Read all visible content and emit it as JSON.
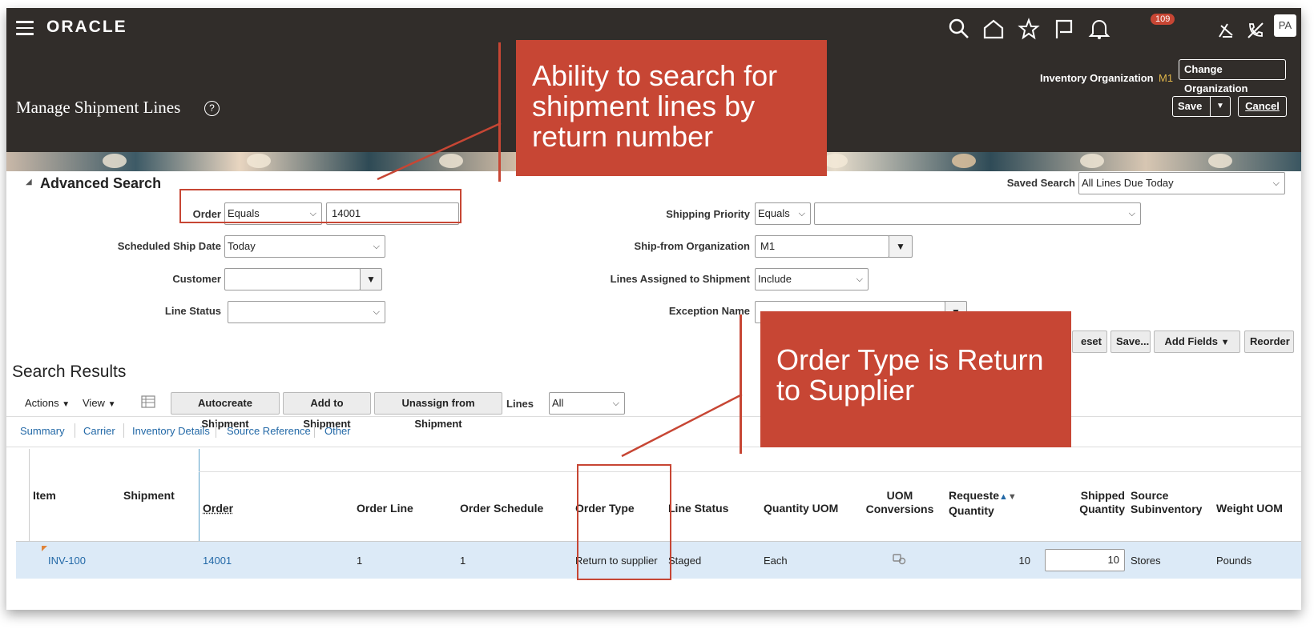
{
  "header": {
    "brand": "ORACLE",
    "notifications_count": "109",
    "avatar_initials": "PA",
    "inventory_org_label": "Inventory Organization",
    "inventory_org_value": "M1",
    "change_org_label": "Change Organization",
    "page_title": "Manage Shipment Lines",
    "help_glyph": "?",
    "save_label": "Save",
    "cancel_label": "Cancel",
    "icons": [
      "menu-icon",
      "search-icon",
      "home-icon",
      "star-icon",
      "flag-icon",
      "bell-icon",
      "sign-icon",
      "phone-off-icon"
    ]
  },
  "search": {
    "title": "Advanced Search",
    "saved_search_label": "Saved Search",
    "saved_search_value": "All Lines Due Today",
    "order_label": "Order",
    "order_operator": "Equals",
    "order_value": "14001",
    "scheduled_ship_date_label": "Scheduled Ship Date",
    "scheduled_ship_date_value": "Today",
    "customer_label": "Customer",
    "customer_value": "",
    "line_status_label": "Line Status",
    "line_status_value": "",
    "shipping_priority_label": "Shipping Priority",
    "shipping_priority_operator": "Equals",
    "shipping_priority_value": "",
    "ship_from_org_label": "Ship-from Organization",
    "ship_from_org_value": "M1",
    "lines_assigned_label": "Lines Assigned to Shipment",
    "lines_assigned_value": "Include",
    "exception_name_label": "Exception Name",
    "exception_name_value": "",
    "reset_label": "eset",
    "save_search_label": "Save...",
    "add_fields_label": "Add Fields",
    "reorder_label": "Reorder"
  },
  "results": {
    "title": "Search Results",
    "actions_label": "Actions",
    "view_label": "View",
    "autocreate_label": "Autocreate Shipment",
    "add_to_shipment_label": "Add to Shipment",
    "unassign_label": "Unassign from Shipment",
    "lines_label": "Lines",
    "lines_value": "All",
    "tabs": [
      "Summary",
      "Carrier",
      "Inventory Details",
      "Source Reference",
      "Other"
    ],
    "columns": {
      "item": "Item",
      "shipment": "Shipment",
      "order": "Order",
      "order_line": "Order Line",
      "order_schedule": "Order Schedule",
      "order_type": "Order Type",
      "line_status": "Line Status",
      "quantity_uom": "Quantity UOM",
      "uom_conversions_1": "UOM",
      "uom_conversions_2": "Conversions",
      "requested_1": "Requeste",
      "requested_2": "Quantity",
      "shipped_1": "Shipped",
      "shipped_2": "Quantity",
      "source_subinv_1": "Source",
      "source_subinv_2": "Subinventory",
      "weight_uom": "Weight UOM"
    },
    "row": {
      "item": "INV-100",
      "shipment": "",
      "order": "14001",
      "order_line": "1",
      "order_schedule": "1",
      "order_type": "Return to supplier",
      "line_status": "Staged",
      "quantity_uom": "Each",
      "requested_quantity": "10",
      "shipped_quantity": "10",
      "source_subinventory": "Stores",
      "weight_uom": "Pounds"
    }
  },
  "callouts": {
    "search_note": "Ability to search for shipment lines by return number",
    "type_note": "Order Type is Return to Supplier"
  },
  "colors": {
    "header_bg": "#312d2a",
    "accent_red": "#c74634",
    "link_blue": "#2369a7",
    "selected_row": "#dceaf7",
    "org_value": "#e0b64a"
  }
}
